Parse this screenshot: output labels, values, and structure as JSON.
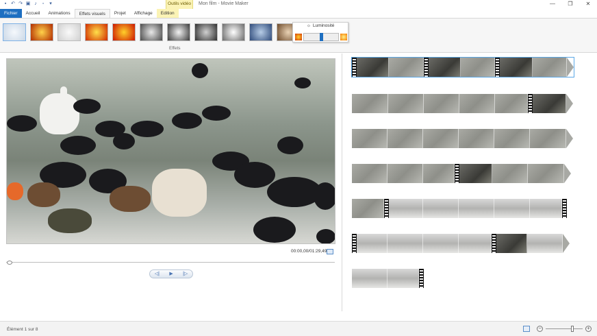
{
  "window": {
    "title": "Mon film - Movie Maker",
    "context_tab": "Outils vidéo",
    "controls": [
      "—",
      "❐",
      "✕"
    ]
  },
  "qat_icons": [
    "save-icon",
    "undo-icon",
    "redo-icon",
    "camera-icon",
    "music-icon",
    "new-icon",
    "dropdown-icon"
  ],
  "tabs": [
    {
      "label": "Fichier"
    },
    {
      "label": "Accueil"
    },
    {
      "label": "Animations"
    },
    {
      "label": "Effets visuels"
    },
    {
      "label": "Projet"
    },
    {
      "label": "Affichage"
    },
    {
      "label": "Edition"
    }
  ],
  "ribbon": {
    "group_label": "Effets",
    "brightness": {
      "label": "Luminosité",
      "value": 0.5
    }
  },
  "effects": [
    {
      "name": "no-effect",
      "c1": "#f5f8fc",
      "c2": "#c9d7e6"
    },
    {
      "name": "warm",
      "c1": "#ffd24a",
      "c2": "#b02a00"
    },
    {
      "name": "grayscale-dim",
      "c1": "#fafafa",
      "c2": "#d0d0d0"
    },
    {
      "name": "orange-flower",
      "c1": "#ffe04a",
      "c2": "#d02a00"
    },
    {
      "name": "red-flower",
      "c1": "#ffd02a",
      "c2": "#cc1400"
    },
    {
      "name": "bw",
      "c1": "#e8e8e8",
      "c2": "#4a4a4a"
    },
    {
      "name": "bw-contrast",
      "c1": "#f2f2f2",
      "c2": "#3a3a3a"
    },
    {
      "name": "bw-dark",
      "c1": "#d0d0d0",
      "c2": "#2e2e2e"
    },
    {
      "name": "bw-light",
      "c1": "#ffffff",
      "c2": "#6a6a6a"
    },
    {
      "name": "blue-tint",
      "c1": "#b6cce6",
      "c2": "#2e4a7a"
    },
    {
      "name": "sepia",
      "c1": "#e9d2b4",
      "c2": "#6d4a2a"
    }
  ],
  "player": {
    "timecode": "00:00,00/01:29,49",
    "position": 0.0
  },
  "statusbar": {
    "text": "Élément 1 sur 8",
    "zoom": 0.72
  }
}
